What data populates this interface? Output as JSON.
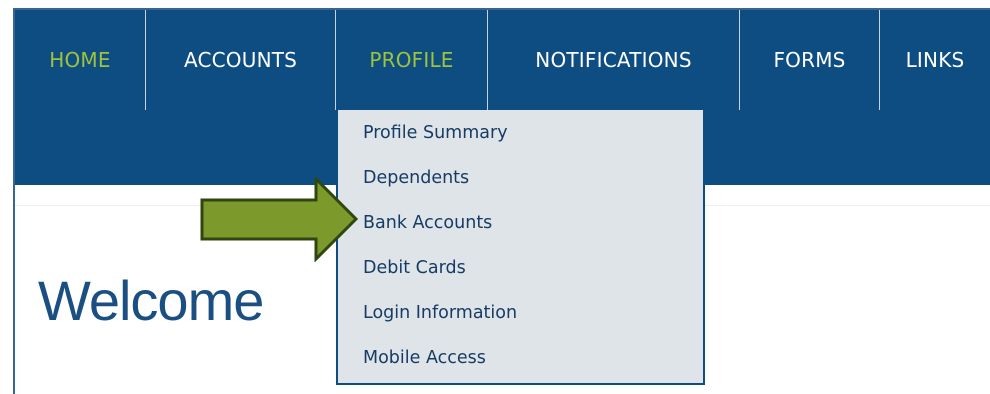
{
  "topnav": {
    "items": [
      {
        "label": "HOME",
        "active": true
      },
      {
        "label": "ACCOUNTS",
        "active": false
      },
      {
        "label": "PROFILE",
        "active": true
      },
      {
        "label": "NOTIFICATIONS",
        "active": false
      },
      {
        "label": "FORMS",
        "active": false
      },
      {
        "label": "LINKS",
        "active": false
      }
    ]
  },
  "profile_menu": {
    "items": [
      "Profile Summary",
      "Dependents",
      "Bank Accounts",
      "Debit Cards",
      "Login Information",
      "Mobile Access"
    ]
  },
  "main": {
    "heading": "Welcome"
  },
  "colors": {
    "nav_bg": "#0d4d82",
    "active_text": "#9ec33c",
    "menu_bg": "#dfe4e9",
    "arrow_fill": "#7c9a2b",
    "heading": "#1b4f82"
  }
}
